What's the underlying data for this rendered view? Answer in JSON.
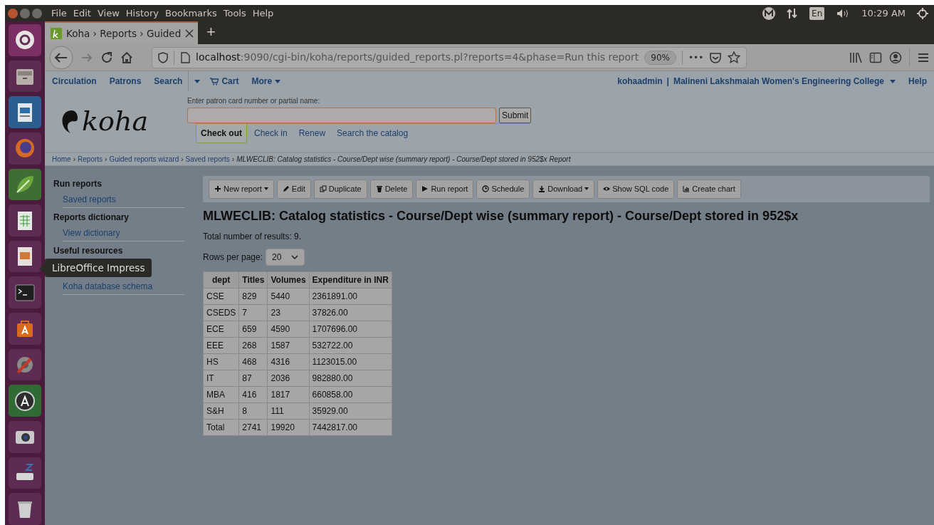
{
  "menubar": {
    "items": [
      "File",
      "Edit",
      "View",
      "History",
      "Bookmarks",
      "Tools",
      "Help"
    ],
    "keyboard": "En",
    "clock": "10:29 AM"
  },
  "launcher": {
    "tooltip": "LibreOffice Impress"
  },
  "browser": {
    "tab": {
      "title": "Koha › Reports › Guided",
      "selected": true
    },
    "new_tab": "+",
    "url_host": "localhost",
    "url_rest": ":9090/cgi-bin/koha/reports/guided_reports.pl?reports=4&phase=Run this report",
    "zoom": "90%",
    "page_actions": "•••"
  },
  "koha_nav": {
    "left": [
      "Circulation",
      "Patrons",
      "Search",
      "Cart",
      "More"
    ],
    "user": "kohaadmin",
    "separator": "|",
    "library": "Malineni Lakshmaiah Women's Engineering College",
    "help": "Help"
  },
  "checkout": {
    "logo": "koha",
    "label": "Enter patron card number or partial name:",
    "submit": "Submit",
    "tabs": [
      {
        "label": "Check out",
        "selected": true
      },
      {
        "label": "Check in",
        "selected": false
      },
      {
        "label": "Renew",
        "selected": false
      },
      {
        "label": "Search the catalog",
        "selected": false
      }
    ]
  },
  "breadcrumbs": {
    "separator": "›",
    "links": [
      "Home",
      "Reports",
      "Guided reports wizard",
      "Saved reports"
    ],
    "current": "MLWECLIB: Catalog statistics - Course/Dept wise (summary report) - Course/Dept stored in 952$x Report"
  },
  "sidebar": [
    {
      "title": "Run reports",
      "links": [
        "Saved reports"
      ]
    },
    {
      "title": "Reports dictionary",
      "links": [
        "View dictionary"
      ]
    },
    {
      "title": "Useful resources",
      "links": [
        "Koha database schema"
      ]
    }
  ],
  "toolbar": [
    {
      "label": "New report",
      "dropdown": true
    },
    {
      "label": "Edit",
      "dropdown": false
    },
    {
      "label": "Duplicate",
      "dropdown": false
    },
    {
      "label": "Delete",
      "dropdown": false
    },
    {
      "label": "Run report",
      "dropdown": false
    },
    {
      "label": "Schedule",
      "dropdown": false
    },
    {
      "label": "Download",
      "dropdown": true
    },
    {
      "label": "Show SQL code",
      "dropdown": false
    },
    {
      "label": "Create chart",
      "dropdown": false
    }
  ],
  "report": {
    "title": "MLWECLIB: Catalog statistics - Course/Dept wise (summary report) - Course/Dept stored in 952$x",
    "total": "Total number of results: 9.",
    "rows_label": "Rows per page:",
    "rows_value": "20"
  },
  "table": {
    "columns": [
      "dept",
      "Titles",
      "Volumes",
      "Expenditure in INR"
    ],
    "rows": [
      [
        "CSE",
        "829",
        "5440",
        "2361891.00"
      ],
      [
        "CSEDS",
        "7",
        "23",
        "37826.00"
      ],
      [
        "ECE",
        "659",
        "4590",
        "1707696.00"
      ],
      [
        "EEE",
        "268",
        "1587",
        "532722.00"
      ],
      [
        "HS",
        "468",
        "4316",
        "1123015.00"
      ],
      [
        "IT",
        "87",
        "2036",
        "982880.00"
      ],
      [
        "MBA",
        "416",
        "1817",
        "660858.00"
      ],
      [
        "S&H",
        "8",
        "111",
        "35929.00"
      ],
      [
        "Total",
        "2741",
        "19920",
        "7442817.00"
      ]
    ]
  }
}
